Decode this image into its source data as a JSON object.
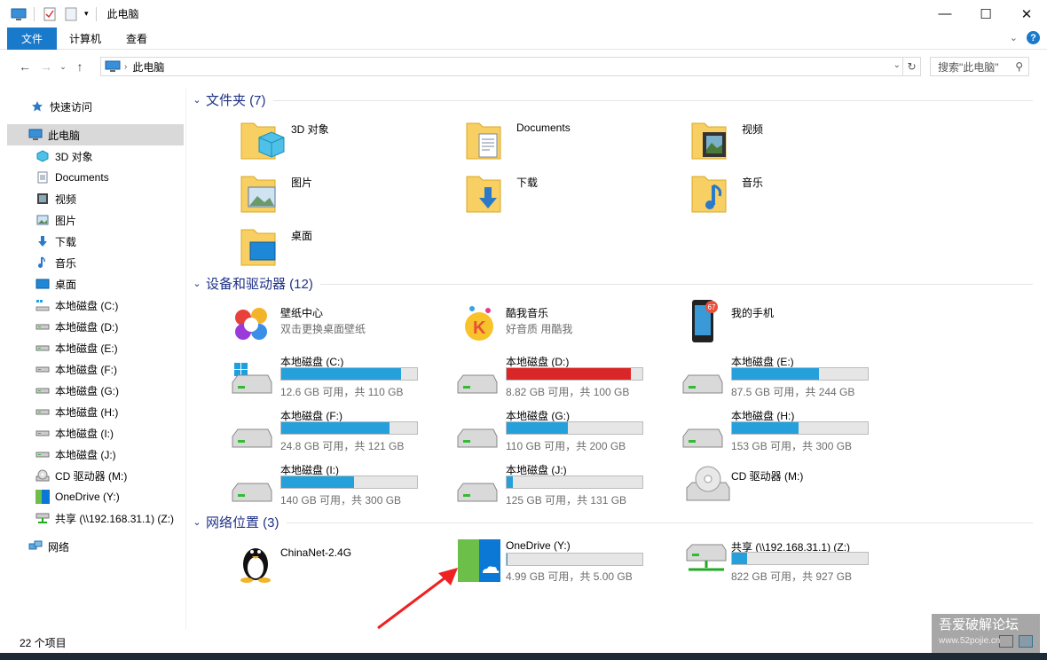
{
  "window": {
    "title": "此电脑",
    "controls": {
      "minimize": "—",
      "maximize": "☐",
      "close": "✕"
    }
  },
  "ribbon": {
    "tabs": [
      {
        "label": "文件",
        "active": true
      },
      {
        "label": "计算机",
        "active": false
      },
      {
        "label": "查看",
        "active": false
      }
    ],
    "help_label": "?"
  },
  "address": {
    "path": "此电脑",
    "search_placeholder": "搜索\"此电脑\""
  },
  "nav": {
    "items": [
      {
        "label": "快速访问",
        "icon": "star-icon"
      },
      {
        "label": "此电脑",
        "icon": "pc-icon",
        "selected": true
      },
      {
        "label": "3D 对象",
        "icon": "cube-icon"
      },
      {
        "label": "Documents",
        "icon": "document-icon"
      },
      {
        "label": "视频",
        "icon": "film-icon"
      },
      {
        "label": "图片",
        "icon": "picture-icon"
      },
      {
        "label": "下载",
        "icon": "download-icon"
      },
      {
        "label": "音乐",
        "icon": "music-icon"
      },
      {
        "label": "桌面",
        "icon": "desktop-icon"
      },
      {
        "label": "本地磁盘 (C:)",
        "icon": "windows-drive-icon"
      },
      {
        "label": "本地磁盘 (D:)",
        "icon": "drive-icon"
      },
      {
        "label": "本地磁盘 (E:)",
        "icon": "drive-icon"
      },
      {
        "label": "本地磁盘 (F:)",
        "icon": "drive-icon"
      },
      {
        "label": "本地磁盘 (G:)",
        "icon": "drive-icon"
      },
      {
        "label": "本地磁盘 (H:)",
        "icon": "drive-icon"
      },
      {
        "label": "本地磁盘 (I:)",
        "icon": "drive-icon"
      },
      {
        "label": "本地磁盘 (J:)",
        "icon": "drive-icon"
      },
      {
        "label": "CD 驱动器 (M:)",
        "icon": "cd-icon"
      },
      {
        "label": "OneDrive (Y:)",
        "icon": "onedrive-icon"
      },
      {
        "label": "共享 (\\\\192.168.31.1) (Z:)",
        "icon": "network-drive-icon"
      },
      {
        "label": "网络",
        "icon": "network-icon"
      }
    ]
  },
  "groups": {
    "folders": {
      "title": "文件夹 (7)"
    },
    "devices": {
      "title": "设备和驱动器 (12)"
    },
    "network": {
      "title": "网络位置 (3)"
    }
  },
  "folders": [
    {
      "name": "3D 对象"
    },
    {
      "name": "Documents"
    },
    {
      "name": "视频"
    },
    {
      "name": "图片"
    },
    {
      "name": "下载"
    },
    {
      "name": "音乐"
    },
    {
      "name": "桌面"
    }
  ],
  "apps": [
    {
      "name": "壁纸中心",
      "sub": "双击更换桌面壁纸"
    },
    {
      "name": "酷我音乐",
      "sub": "好音质 用酷我"
    },
    {
      "name": "我的手机",
      "sub": "",
      "badge": "67"
    }
  ],
  "drives": [
    {
      "name": "本地磁盘 (C:)",
      "free": "12.6 GB 可用，共 110 GB",
      "used_pct": 88.5,
      "warn": false
    },
    {
      "name": "本地磁盘 (D:)",
      "free": "8.82 GB 可用，共 100 GB",
      "used_pct": 91.2,
      "warn": true
    },
    {
      "name": "本地磁盘 (E:)",
      "free": "87.5 GB 可用，共 244 GB",
      "used_pct": 64.1,
      "warn": false
    },
    {
      "name": "本地磁盘 (F:)",
      "free": "24.8 GB 可用，共 121 GB",
      "used_pct": 79.5,
      "warn": false
    },
    {
      "name": "本地磁盘 (G:)",
      "free": "110 GB 可用，共 200 GB",
      "used_pct": 45.0,
      "warn": false
    },
    {
      "name": "本地磁盘 (H:)",
      "free": "153 GB 可用，共 300 GB",
      "used_pct": 49.0,
      "warn": false
    },
    {
      "name": "本地磁盘 (I:)",
      "free": "140 GB 可用，共 300 GB",
      "used_pct": 53.3,
      "warn": false
    },
    {
      "name": "本地磁盘 (J:)",
      "free": "125 GB 可用，共 131 GB",
      "used_pct": 4.6,
      "warn": false
    }
  ],
  "cd": {
    "name": "CD 驱动器 (M:)"
  },
  "network_items": [
    {
      "name": "ChinaNet-2.4G"
    },
    {
      "name": "OneDrive (Y:)",
      "free": "4.99 GB 可用，共 5.00 GB",
      "used_pct": 0.2
    },
    {
      "name": "共享 (\\\\192.168.31.1) (Z:)",
      "free": "822 GB 可用，共 927 GB",
      "used_pct": 11.3
    }
  ],
  "status": {
    "count": "22 个项目"
  },
  "watermark": {
    "line1": "吾爱破解论坛",
    "line2": "www.52pojie.cn"
  },
  "colors": {
    "accent": "#1979ca",
    "bar": "#26a0da",
    "bar_warn": "#da2626",
    "group_title": "#1e3287"
  }
}
